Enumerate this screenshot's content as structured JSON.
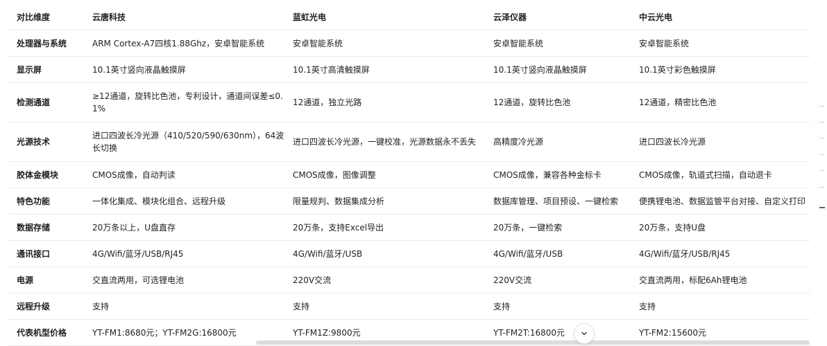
{
  "table": {
    "headers": [
      "对比维度",
      "云唐科技",
      "蓝虹光电",
      "云泽仪器",
      "中云光电"
    ],
    "rows": [
      [
        "处理器与系统",
        "ARM Cortex-A7四核1.88Ghz，安卓智能系统",
        "安卓智能系统",
        "安卓智能系统",
        "安卓智能系统"
      ],
      [
        "显示屏",
        "10.1英寸竖向液晶触摸屏",
        "10.1英寸高清触摸屏",
        "10.1英寸竖向液晶触摸屏",
        "10.1英寸彩色触摸屏"
      ],
      [
        "检测通道",
        "≥12通道，旋转比色池，专利设计，通道间误差≤0.1%",
        "12通道，独立光路",
        "12通道，旋转比色池",
        "12通道，精密比色池"
      ],
      [
        "光源技术",
        "进口四波长冷光源（410/520/590/630nm），64波长切换",
        "进口四波长冷光源，一键校准，光源数据永不丢失",
        "高精度冷光源",
        "进口四波长冷光源"
      ],
      [
        "胶体金模块",
        "CMOS成像，自动判读",
        "CMOS成像，图像调整",
        "CMOS成像，兼容各种金标卡",
        "CMOS成像，轨道式扫描，自动退卡"
      ],
      [
        "特色功能",
        "一体化集成、模块化组合、远程升级",
        "限量规判、数据集成分析",
        "数据库管理、项目预设、一键检索",
        "便携锂电池、数据监管平台对接、自定义打印"
      ],
      [
        "数据存储",
        "20万条以上，U盘直存",
        "20万条，支持Excel导出",
        "20万条，一键检索",
        "20万条，支持U盘"
      ],
      [
        "通讯接口",
        "4G/Wifi/蓝牙/USB/RJ45",
        "4G/Wifi/蓝牙/USB",
        "4G/Wifi/蓝牙/USB",
        "4G/Wifi/蓝牙/USB/RJ45"
      ],
      [
        "电源",
        "交直流两用，可选锂电池",
        "220V交流",
        "220V交流",
        "交直流两用，标配6Ah锂电池"
      ],
      [
        "远程升级",
        "支持",
        "支持",
        "支持",
        "支持"
      ],
      [
        "代表机型价格",
        "YT-FM1:8680元；YT-FM2G:16800元",
        "YT-FM1Z:9800元",
        "YT-FM2T:16800元",
        "YT-FM2:15600元"
      ]
    ]
  },
  "icons": {
    "scroll_down": "chevron-down-icon"
  }
}
